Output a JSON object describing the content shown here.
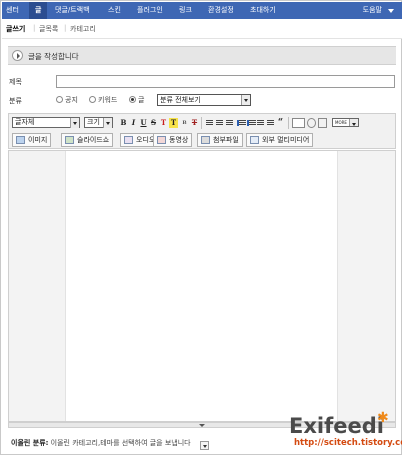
{
  "nav": {
    "items": [
      "센터",
      "글",
      "댓글/트랙백",
      "스킨",
      "플러그인",
      "링크",
      "환경설정",
      "초대하기"
    ],
    "active_index": 1,
    "help_label": "도움말"
  },
  "subnav": {
    "items": [
      "글쓰기",
      "글목록",
      "카테고리"
    ],
    "active_index": 0
  },
  "page_header": "글을 작성합니다",
  "form": {
    "title_label": "제목",
    "title_value": "",
    "category_label": "분류",
    "radio_options": [
      "공지",
      "키워드",
      "글"
    ],
    "radio_selected": "글",
    "category_select": "분류 전체보기"
  },
  "toolbar": {
    "font_select": "글자체",
    "size_select": "크기",
    "format_buttons": [
      "B",
      "I",
      "U",
      "S",
      "T",
      "T",
      "B",
      "T"
    ],
    "misc_select": "MORE",
    "media_buttons": [
      "이미지",
      "슬라이드쇼",
      "오디오",
      "동영상",
      "첨부파일",
      "외부 멀티미디어"
    ]
  },
  "footer": {
    "label": "이올린 분류:",
    "text": "이올린 카테고리,테마를 선택하여 글을 보냅니다"
  },
  "watermark": {
    "brand": "Exifeedi",
    "url": "http://scitech.tistory.com/"
  },
  "colors": {
    "nav_bg": "#3e67b4",
    "nav_active_bg": "#2b4d90",
    "watermark_star": "#f08a1a",
    "watermark_url": "#d44a10"
  }
}
